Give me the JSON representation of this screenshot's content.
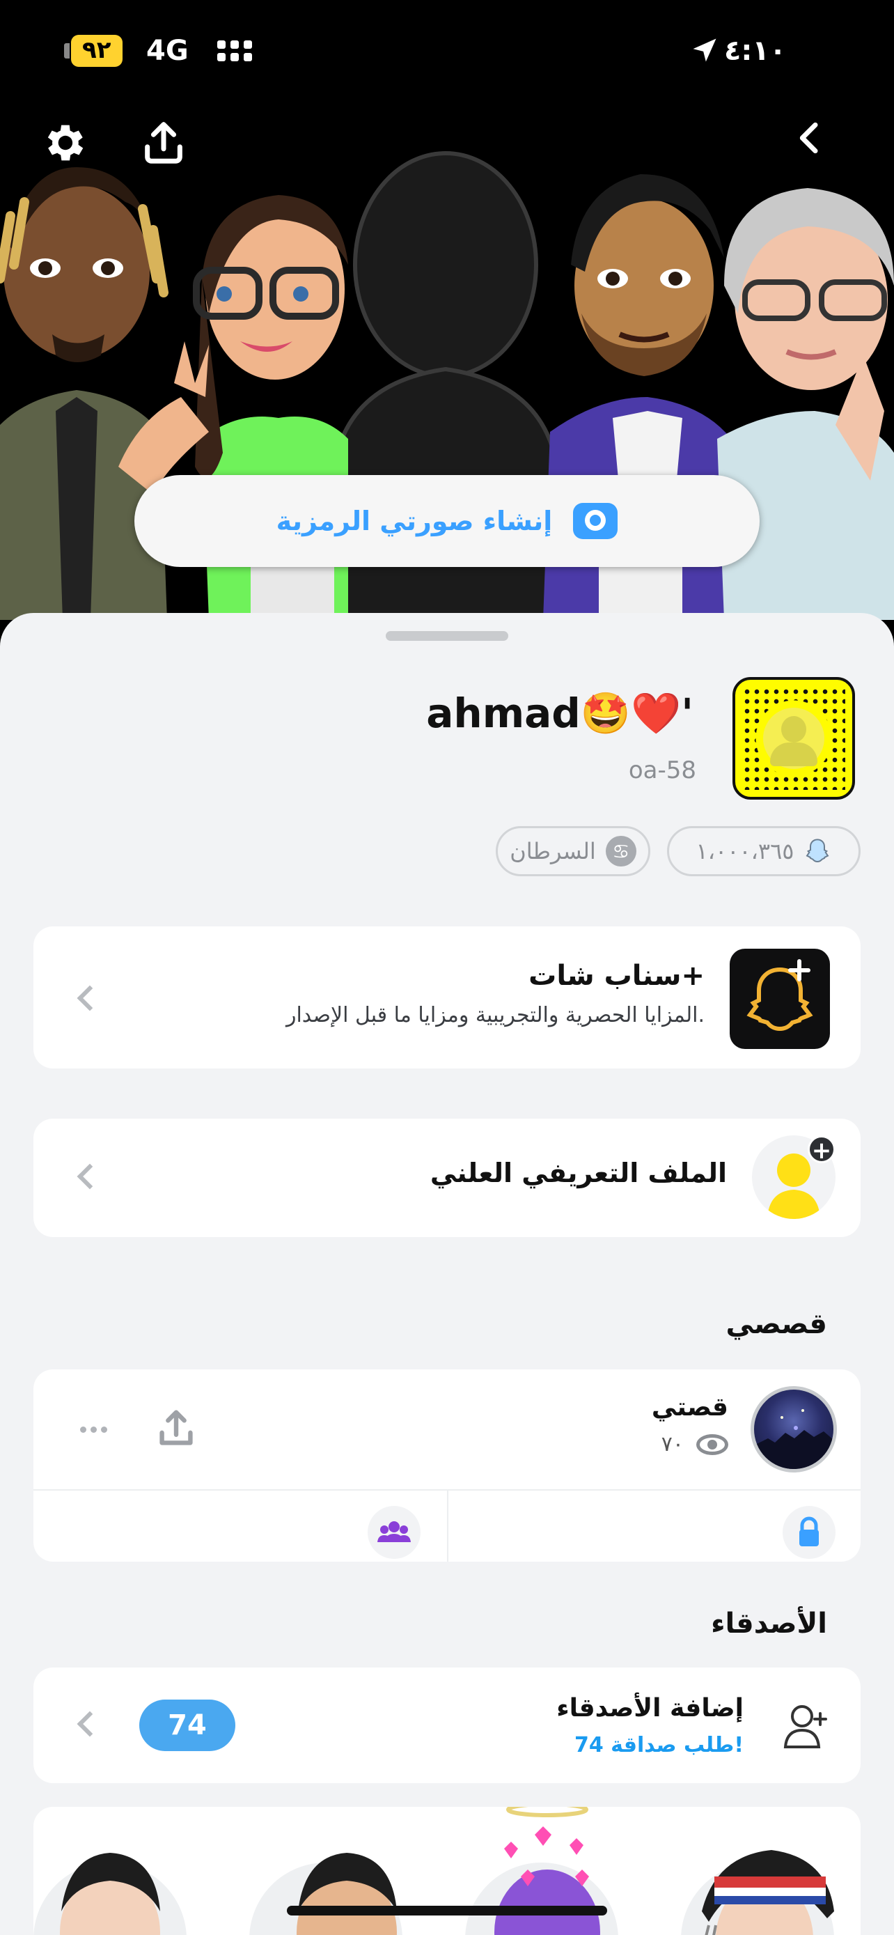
{
  "status_bar": {
    "battery": "٩٢",
    "network": "4G",
    "time": "٤:١٠"
  },
  "header": {
    "create_button_label": "إنشاء صورتي الرمزية",
    "icons": [
      "settings-icon",
      "share-icon",
      "back-icon"
    ]
  },
  "profile": {
    "display_name": "ahmad🤩❤️'",
    "username": "oa-58",
    "score": "١،٠٠٠،٣٦٥",
    "zodiac_label": "السرطان",
    "zodiac_symbol": "♋"
  },
  "snapchat_plus": {
    "title": "سناب شات+",
    "subtitle": "المزايا الحصرية والتجريبية ومزايا ما قبل الإصدار."
  },
  "public_profile": {
    "title": "الملف التعريفي العلني"
  },
  "stories": {
    "section_title": "قصصي",
    "my_story_label": "قصتي",
    "views": "٧٠"
  },
  "friends": {
    "section_title": "الأصدقاء",
    "add_friends_label": "إضافة الأصدقاء",
    "requests_text": "74 طلب صداقة!",
    "requests_count": "74"
  },
  "colors": {
    "accent_blue": "#3aa0ff",
    "snap_yellow": "#fffc00",
    "badge_blue": "#4aa8f0",
    "sheet_bg": "#f2f3f5"
  }
}
